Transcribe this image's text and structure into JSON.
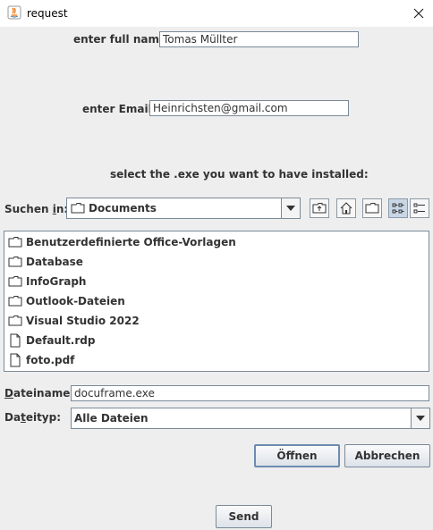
{
  "window": {
    "title": "request",
    "app_icon": "java-icon",
    "close_icon": "close-icon"
  },
  "form": {
    "name_label": "enter full name:",
    "name_value": "Tomas Müllter",
    "email_label": "enter Email:",
    "email_value": "Heinrichsten@gmail.com",
    "exe_prompt": "select the .exe you want to have installed:"
  },
  "chooser": {
    "look_in_label_pre": "Suchen ",
    "look_in_label_mn": "i",
    "look_in_label_post": "n:",
    "look_in_value": "Documents",
    "toolbar_icons": [
      "up-folder-icon",
      "home-icon",
      "new-folder-icon",
      "list-view-icon",
      "details-view-icon"
    ],
    "files": [
      {
        "name": "Benutzerdefinierte Office-Vorlagen",
        "type": "folder"
      },
      {
        "name": "Database",
        "type": "folder"
      },
      {
        "name": "InfoGraph",
        "type": "folder"
      },
      {
        "name": "Outlook-Dateien",
        "type": "folder"
      },
      {
        "name": "Visual Studio 2022",
        "type": "folder"
      },
      {
        "name": "Default.rdp",
        "type": "file"
      },
      {
        "name": "foto.pdf",
        "type": "file"
      }
    ],
    "filename_label_mn": "D",
    "filename_label_rest": "ateiname:",
    "filename_value": "docuframe.exe",
    "filetype_label_pre": "Da",
    "filetype_label_mn": "t",
    "filetype_label_post": "eityp:",
    "filetype_value": "Alle Dateien",
    "open_label": "Öffnen",
    "cancel_label": "Abbrechen"
  },
  "send_label": "Send"
}
